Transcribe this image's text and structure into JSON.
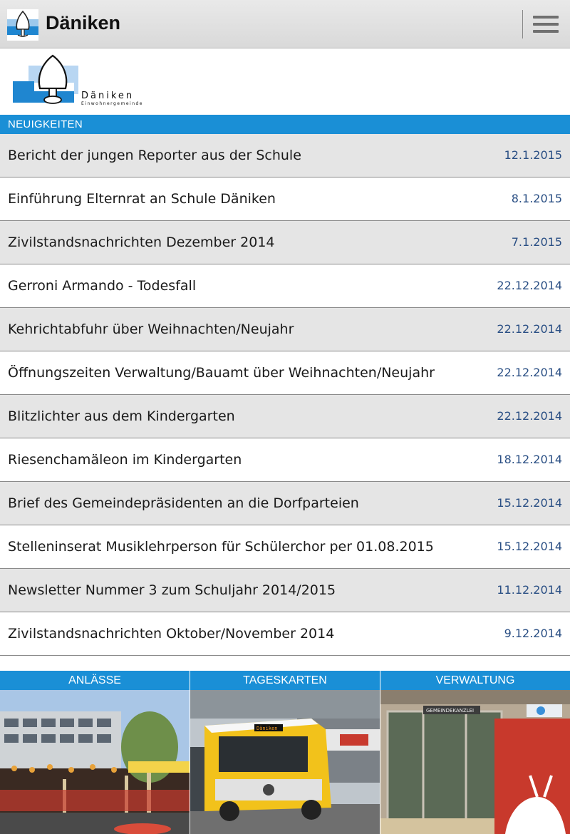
{
  "header": {
    "title": "Däniken",
    "menu_icon": "hamburger-menu-icon"
  },
  "logo": {
    "name": "Däniken",
    "subtitle": "Einwohnergemeinde"
  },
  "news": {
    "section_title": "NEUIGKEITEN",
    "items": [
      {
        "title": "Bericht der jungen Reporter aus der Schule",
        "date": "12.1.2015"
      },
      {
        "title": "Einführung Elternrat an Schule Däniken",
        "date": "8.1.2015"
      },
      {
        "title": "Zivilstandsnachrichten Dezember 2014",
        "date": "7.1.2015"
      },
      {
        "title": "Gerroni Armando - Todesfall",
        "date": "22.12.2014"
      },
      {
        "title": "Kehrichtabfuhr über Weihnachten/Neujahr",
        "date": "22.12.2014"
      },
      {
        "title": "Öffnungszeiten Verwaltung/Bauamt über Weihnachten/Neujahr",
        "date": "22.12.2014"
      },
      {
        "title": "Blitzlichter aus dem Kindergarten",
        "date": "22.12.2014"
      },
      {
        "title": "Riesenchamäleon im Kindergarten",
        "date": "18.12.2014"
      },
      {
        "title": "Brief des Gemeindepräsidenten an die Dorfparteien",
        "date": "15.12.2014"
      },
      {
        "title": "Stelleninserat Musiklehrperson für Schülerchor per 01.08.2015",
        "date": "15.12.2014"
      },
      {
        "title": "Newsletter Nummer 3 zum Schuljahr 2014/2015",
        "date": "11.12.2014"
      },
      {
        "title": "Zivilstandsnachrichten Oktober/November 2014",
        "date": "9.12.2014"
      }
    ]
  },
  "tiles": [
    {
      "label": "ANLÄSSE"
    },
    {
      "label": "TAGESKARTEN",
      "bus_sign": "Däniken"
    },
    {
      "label": "VERWALTUNG",
      "sign": "GEMEINDEKANZLEI"
    }
  ],
  "colors": {
    "accent": "#1a8fd6",
    "date_text": "#2a4f84",
    "row_alt": "#e5e5e5"
  }
}
